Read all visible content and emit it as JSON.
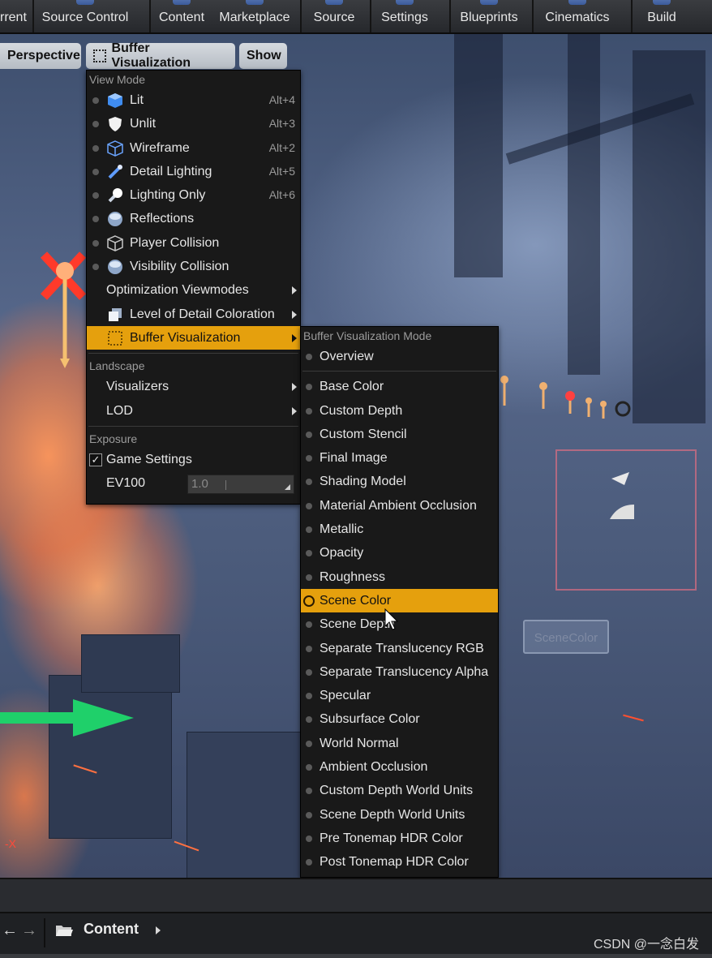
{
  "toolbar": {
    "items": [
      "rrent",
      "Source Control",
      "Content",
      "Marketplace",
      "Source",
      "Settings",
      "Blueprints",
      "Cinematics",
      "Build"
    ]
  },
  "viewport": {
    "perspective_label": "Perspective",
    "buffer_vis_label": "Buffer Visualization",
    "show_label": "Show",
    "scene_color_tag": "SceneColor",
    "axis_x_label": "-X"
  },
  "view_menu": {
    "section_view_mode": "View Mode",
    "items": [
      {
        "label": "Lit",
        "shortcut": "Alt+4"
      },
      {
        "label": "Unlit",
        "shortcut": "Alt+3"
      },
      {
        "label": "Wireframe",
        "shortcut": "Alt+2"
      },
      {
        "label": "Detail Lighting",
        "shortcut": "Alt+5"
      },
      {
        "label": "Lighting Only",
        "shortcut": "Alt+6"
      },
      {
        "label": "Reflections",
        "shortcut": ""
      },
      {
        "label": "Player Collision",
        "shortcut": ""
      },
      {
        "label": "Visibility Collision",
        "shortcut": ""
      },
      {
        "label": "Optimization Viewmodes",
        "shortcut": ""
      },
      {
        "label": "Level of Detail Coloration",
        "shortcut": ""
      },
      {
        "label": "Buffer Visualization",
        "shortcut": ""
      }
    ],
    "section_landscape": "Landscape",
    "landscape_items": [
      "Visualizers",
      "LOD"
    ],
    "section_exposure": "Exposure",
    "game_settings_label": "Game Settings",
    "game_settings_checked": true,
    "ev100_label": "EV100",
    "ev100_value": "1.0"
  },
  "buffer_menu": {
    "title": "Buffer Visualization Mode",
    "overview": "Overview",
    "items": [
      "Base Color",
      "Custom Depth",
      "Custom Stencil",
      "Final Image",
      "Shading Model",
      "Material Ambient Occlusion",
      "Metallic",
      "Opacity",
      "Roughness",
      "Scene Color",
      "Scene Depth",
      "Separate Translucency RGB",
      "Separate Translucency Alpha",
      "Specular",
      "Subsurface Color",
      "World Normal",
      "Ambient Occlusion",
      "Custom Depth World Units",
      "Scene Depth World Units",
      "Pre Tonemap HDR Color",
      "Post Tonemap HDR Color"
    ],
    "selected": "Scene Color"
  },
  "content_bar": {
    "label": "Content"
  },
  "watermark": "CSDN @一念白发",
  "colors": {
    "highlight": "#e5a00d",
    "menu_bg": "#191919"
  }
}
